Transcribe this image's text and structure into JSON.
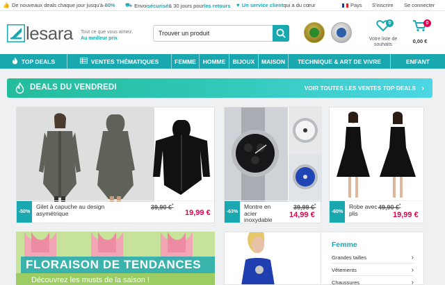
{
  "topbar": {
    "promo1_prefix": "De nouveaux deals chaque jour jusqu'à ",
    "promo1_highlight": "-80%",
    "promo2_prefix": "Envoi ",
    "promo2_highlight": "sécurisé",
    "promo2_middle": " & 30 jours pour ",
    "promo2_highlight2": "les retours",
    "promo3_highlight": "Un service client",
    "promo3_suffix": " qui a du cœur",
    "country": "Pays",
    "signup": "S'inscrire",
    "login": "Se connecter"
  },
  "header": {
    "logo_text": "lesara",
    "tagline_line1": "Tout ce que vous aimez.",
    "tagline_line2": "Au meilleur prix",
    "search_placeholder": "Trouver un produit",
    "wishlist_count": "0",
    "wishlist_label": "Votre liste de souhaits",
    "cart_count": "0",
    "cart_total": "0,00 €"
  },
  "nav": {
    "items": [
      {
        "label": "TOP DEALS",
        "icon": "flame-icon"
      },
      {
        "label": "VENTES THÉMATIQUES",
        "icon": "grid-list-icon"
      },
      {
        "label": "FEMME"
      },
      {
        "label": "HOMME"
      },
      {
        "label": "BIJOUX"
      },
      {
        "label": "MAISON"
      },
      {
        "label": "TECHNIQUE & ART DE VIVRE"
      },
      {
        "label": "ENFANT"
      }
    ]
  },
  "deals": {
    "title": "DEALS DU VENDREDI",
    "link": "VOIR TOUTES LES VENTES TOP DEALS"
  },
  "products": [
    {
      "discount": "-50%",
      "name": "Gilet à capuche au design asymétrique",
      "old_price": "39,90 €",
      "old_marker": "*",
      "new_price": "19,99 €"
    },
    {
      "discount": "-63%",
      "name": "Montre en acier inoxydable",
      "old_price": "39,99 €",
      "old_marker": "*",
      "new_price": "14,99 €"
    },
    {
      "discount": "-60%",
      "name": "Robe avec plis",
      "old_price": "49,90 €",
      "old_marker": "*",
      "new_price": "19,99 €"
    }
  ],
  "promo_banner": {
    "title": "FLORAISON DE TENDANCES",
    "subtitle": "Découvrez les musts de la saison !"
  },
  "category_box": {
    "title": "Femme",
    "items": [
      "Grandes tailles",
      "Vêtements",
      "Chaussures"
    ]
  },
  "colors": {
    "accent": "#1aa8b0",
    "price_red": "#e3004f"
  }
}
